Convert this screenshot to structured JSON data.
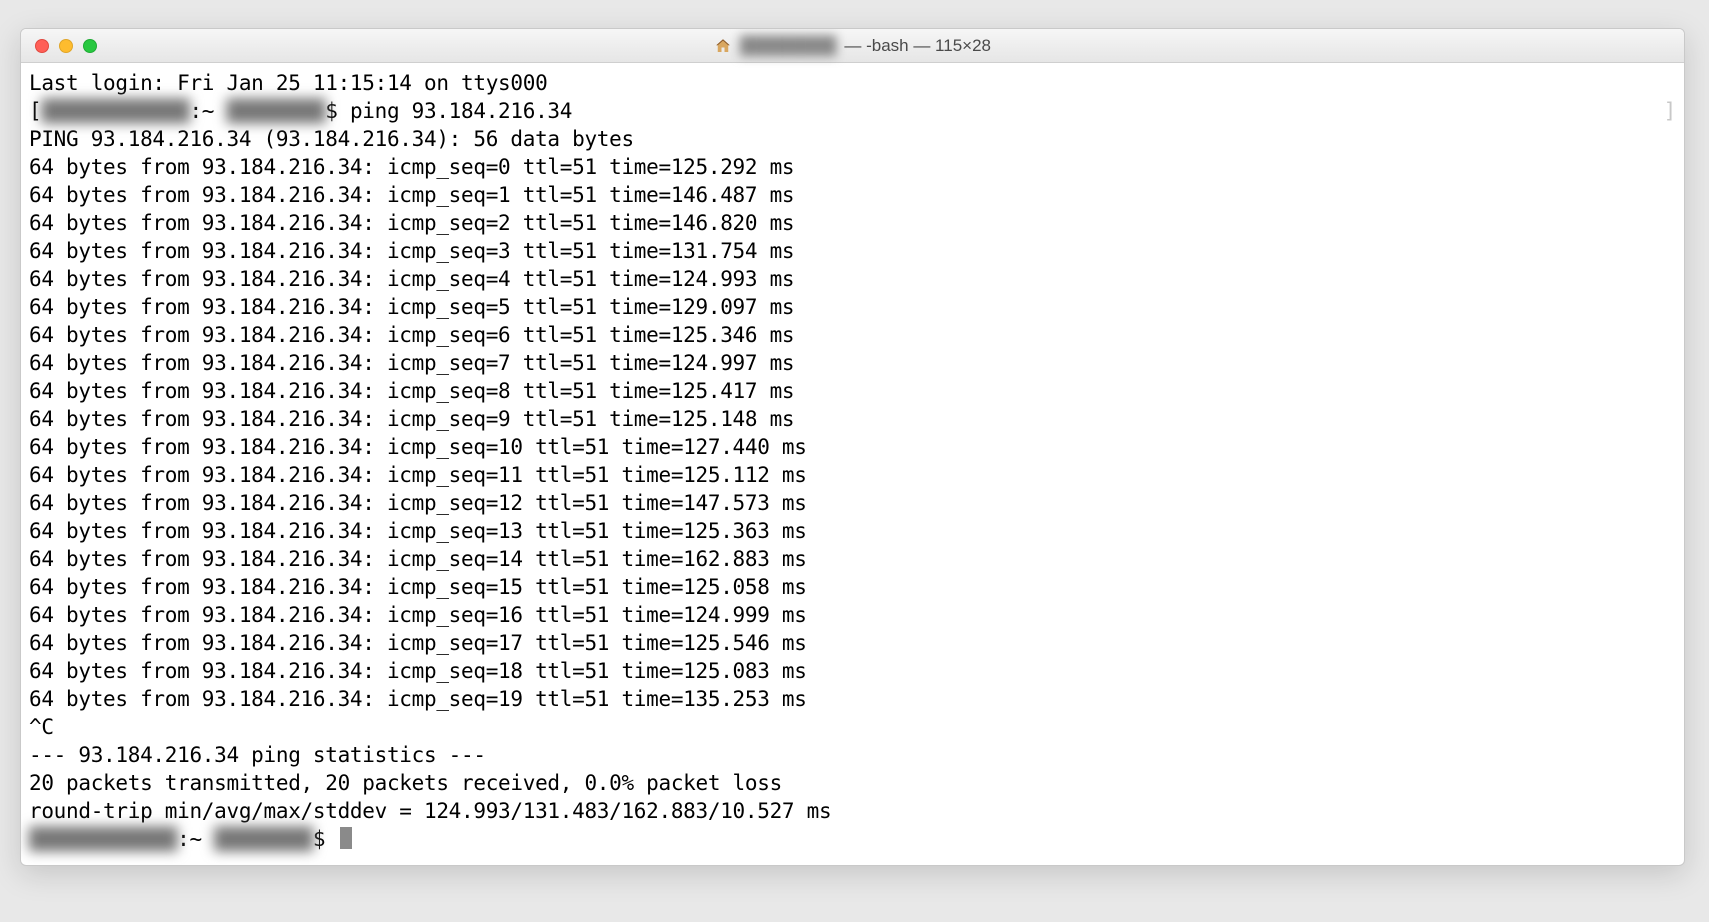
{
  "titlebar": {
    "user_blurred": "████████",
    "suffix": " — -bash — 115×28"
  },
  "terminal": {
    "last_login": "Last login: Fri Jan 25 11:15:14 on ttys000",
    "prompt_host_blur": "████████████",
    "prompt_sep": ":~ ",
    "prompt_user_blur": "████████",
    "prompt_symbol": "$ ",
    "command": "ping 93.184.216.34",
    "ping_header": "PING 93.184.216.34 (93.184.216.34): 56 data bytes",
    "replies": [
      "64 bytes from 93.184.216.34: icmp_seq=0 ttl=51 time=125.292 ms",
      "64 bytes from 93.184.216.34: icmp_seq=1 ttl=51 time=146.487 ms",
      "64 bytes from 93.184.216.34: icmp_seq=2 ttl=51 time=146.820 ms",
      "64 bytes from 93.184.216.34: icmp_seq=3 ttl=51 time=131.754 ms",
      "64 bytes from 93.184.216.34: icmp_seq=4 ttl=51 time=124.993 ms",
      "64 bytes from 93.184.216.34: icmp_seq=5 ttl=51 time=129.097 ms",
      "64 bytes from 93.184.216.34: icmp_seq=6 ttl=51 time=125.346 ms",
      "64 bytes from 93.184.216.34: icmp_seq=7 ttl=51 time=124.997 ms",
      "64 bytes from 93.184.216.34: icmp_seq=8 ttl=51 time=125.417 ms",
      "64 bytes from 93.184.216.34: icmp_seq=9 ttl=51 time=125.148 ms",
      "64 bytes from 93.184.216.34: icmp_seq=10 ttl=51 time=127.440 ms",
      "64 bytes from 93.184.216.34: icmp_seq=11 ttl=51 time=125.112 ms",
      "64 bytes from 93.184.216.34: icmp_seq=12 ttl=51 time=147.573 ms",
      "64 bytes from 93.184.216.34: icmp_seq=13 ttl=51 time=125.363 ms",
      "64 bytes from 93.184.216.34: icmp_seq=14 ttl=51 time=162.883 ms",
      "64 bytes from 93.184.216.34: icmp_seq=15 ttl=51 time=125.058 ms",
      "64 bytes from 93.184.216.34: icmp_seq=16 ttl=51 time=124.999 ms",
      "64 bytes from 93.184.216.34: icmp_seq=17 ttl=51 time=125.546 ms",
      "64 bytes from 93.184.216.34: icmp_seq=18 ttl=51 time=125.083 ms",
      "64 bytes from 93.184.216.34: icmp_seq=19 ttl=51 time=135.253 ms"
    ],
    "interrupt": "^C",
    "stats_header": "--- 93.184.216.34 ping statistics ---",
    "stats_packets": "20 packets transmitted, 20 packets received, 0.0% packet loss",
    "stats_rtt": "round-trip min/avg/max/stddev = 124.993/131.483/162.883/10.527 ms"
  }
}
